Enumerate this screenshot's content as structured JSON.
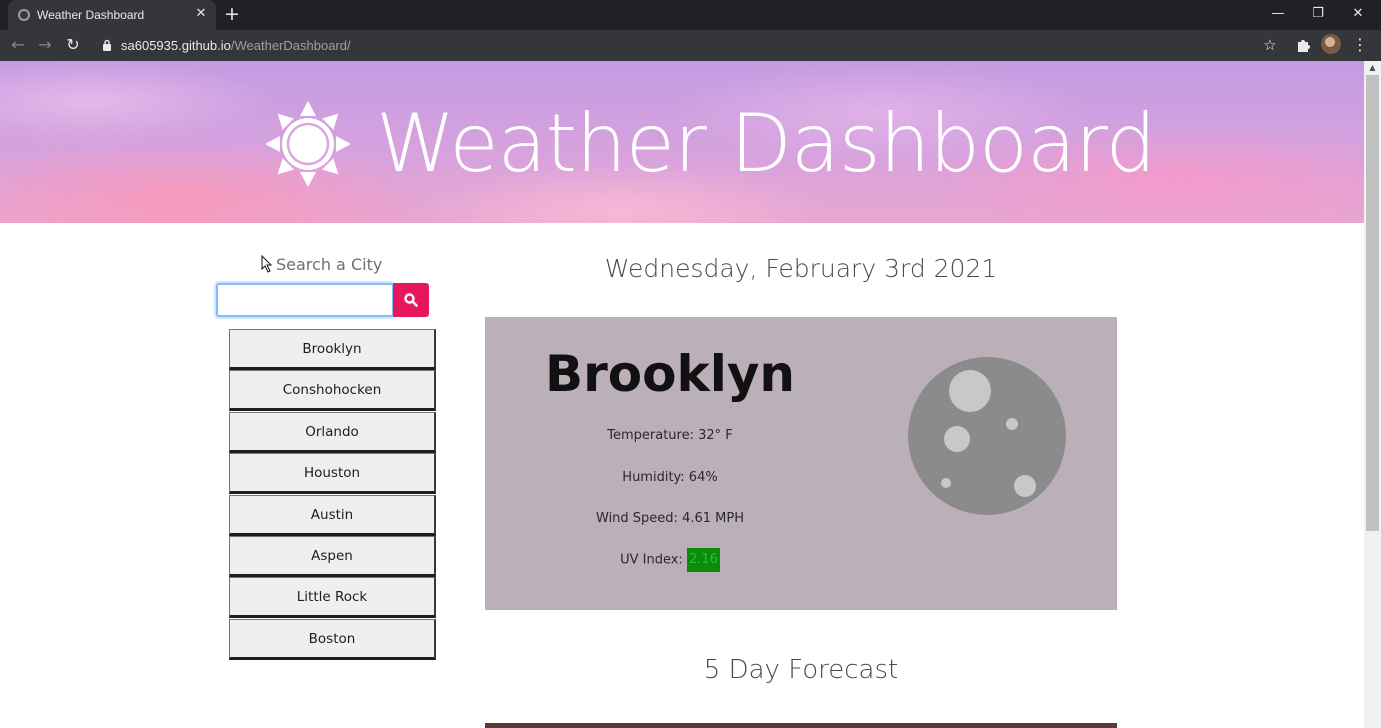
{
  "browser": {
    "tab_title": "Weather Dashboard",
    "tab_close": "✕",
    "new_tab": "+",
    "url_domain": "sa605935.github.io",
    "url_path": "/WeatherDashboard/",
    "back": "←",
    "forward": "→",
    "reload": "↻",
    "star": "☆",
    "menu": "⋮",
    "minimize": "—",
    "restore": "❐",
    "close": "✕"
  },
  "header": {
    "title": "Weather Dashboard",
    "icon": "sun-icon"
  },
  "search": {
    "label": "Search a City",
    "placeholder": "",
    "value": "",
    "button_icon": "search-icon"
  },
  "cities": [
    "Brooklyn",
    "Conshohocken",
    "Orlando",
    "Houston",
    "Austin",
    "Aspen",
    "Little Rock",
    "Boston"
  ],
  "current": {
    "date": "Wednesday, February 3rd 2021",
    "city": "Brooklyn",
    "temperature": "Temperature: 32° F",
    "humidity": "Humidity: 64%",
    "wind": "Wind Speed: 4.61 MPH",
    "uv_label": "UV Index:",
    "uv_value": "2.16",
    "weather_icon": "moon-icon",
    "uv_color": "#0e8a0e"
  },
  "forecast": {
    "heading": "5 Day Forecast"
  },
  "colors": {
    "search_button": "#e8175d",
    "card_background": "#bbafba",
    "header_gradient": "#c49be2"
  }
}
